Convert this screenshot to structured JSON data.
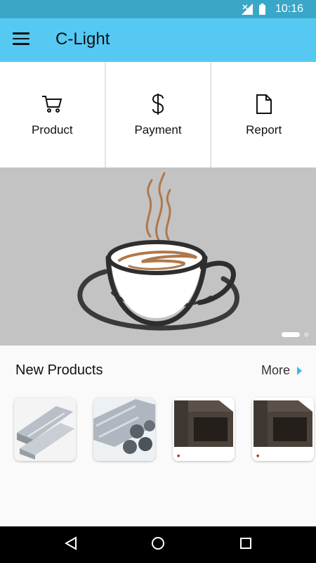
{
  "status_bar": {
    "time": "10:16",
    "icons": [
      "signal-icon",
      "battery-icon"
    ]
  },
  "app_bar": {
    "title": "C-Light",
    "menu_icon": "hamburger-menu-icon"
  },
  "tiles": [
    {
      "label": "Product",
      "icon": "shopping-cart-icon"
    },
    {
      "label": "Payment",
      "icon": "dollar-icon"
    },
    {
      "label": "Report",
      "icon": "document-icon"
    }
  ],
  "banner": {
    "image": "coffee-cup-illustration",
    "active_slide": 1,
    "slide_count": 2
  },
  "new_products": {
    "heading": "New Products",
    "more_label": "More",
    "items": [
      "aluminium-profiles",
      "steel-pipes",
      "square-tube",
      "square-tube"
    ]
  },
  "nav_bar": {
    "icons": [
      "back-icon",
      "home-icon",
      "recents-icon"
    ]
  },
  "colors": {
    "app_bar": "#56c9f3",
    "status_bar": "#3aa7c9",
    "accent": "#39b9ec"
  }
}
